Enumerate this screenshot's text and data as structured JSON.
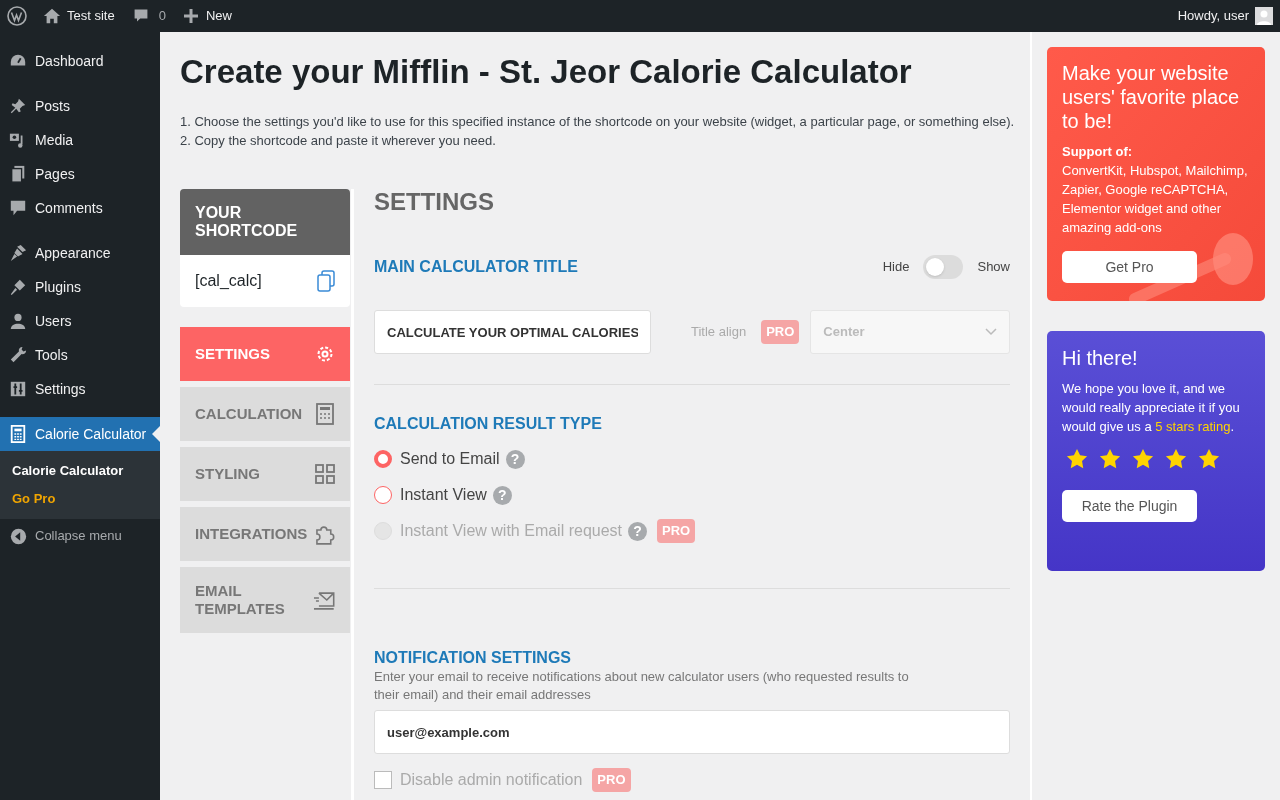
{
  "admin_bar": {
    "site": "Test site",
    "comments": "0",
    "new": "New",
    "greeting": "Howdy, user"
  },
  "menu": [
    {
      "items": [
        {
          "label": "Dashboard",
          "selected": false
        }
      ]
    },
    {
      "items": [
        {
          "label": "Posts",
          "selected": false
        },
        {
          "label": "Media",
          "selected": false
        },
        {
          "label": "Pages",
          "selected": false
        },
        {
          "label": "Comments",
          "selected": false
        }
      ]
    },
    {
      "items": [
        {
          "label": "Appearance",
          "selected": false
        },
        {
          "label": "Plugins",
          "selected": false
        },
        {
          "label": "Users",
          "selected": false
        },
        {
          "label": "Tools",
          "selected": false
        },
        {
          "label": "Settings",
          "selected": false
        }
      ]
    },
    {
      "items": [
        {
          "label": "Calorie Calculator",
          "selected": true
        }
      ]
    }
  ],
  "submenu": [
    {
      "label": "Calorie Calculator",
      "kind": "page",
      "selected": true
    },
    {
      "label": "Go Pro",
      "kind": "promo",
      "selected": false
    }
  ],
  "collapse": "Collapse menu",
  "page": {
    "title": "Create your Mifflin - St. Jeor Calorie Calculator",
    "instructions": [
      "1. Choose the settings you'd like to use for this specified instance of the shortcode on your website (widget, a particular page, or something else).",
      "2. Copy the shortcode and paste it wherever you need."
    ]
  },
  "shortcode": {
    "heading": "YOUR SHORTCODE",
    "code": "[cal_calc]"
  },
  "tabs": [
    {
      "label": "SETTINGS",
      "selected": true
    },
    {
      "label": "CALCULATION",
      "selected": false
    },
    {
      "label": "STYLING",
      "selected": false
    },
    {
      "label": "INTEGRATIONS",
      "selected": false
    },
    {
      "label": "EMAIL TEMPLATES",
      "selected": false
    }
  ],
  "settings": {
    "heading": "SETTINGS",
    "title_section": {
      "heading": "MAIN CALCULATOR TITLE",
      "hide_label": "Hide",
      "show_label": "Show",
      "on": false,
      "title_value": "CALCULATE YOUR OPTIMAL CALORIES",
      "align_label": "Title align",
      "align_badge": "PRO",
      "align_value": "Center"
    },
    "result_type": {
      "heading": "CALCULATION RESULT TYPE",
      "options": [
        {
          "label": "Send to Email",
          "help": "?",
          "selected": true,
          "disabled": false
        },
        {
          "label": "Instant View",
          "help": "?",
          "selected": false,
          "disabled": false
        },
        {
          "label": "Instant View with Email request",
          "help": "?",
          "badge": "PRO",
          "selected": false,
          "disabled": true
        }
      ]
    },
    "notification": {
      "heading": "NOTIFICATION SETTINGS",
      "description": "Enter your email to receive notifications about new calculator users (who requested results to their email) and their email addresses",
      "email": "user@example.com",
      "checkbox": {
        "label": "Disable admin notification",
        "badge": "PRO",
        "checked": false,
        "disabled": true
      }
    }
  },
  "pro_card": {
    "title": "Make your website users' favorite place to be!",
    "support_label": "Support of:",
    "support_text": "ConvertKit, Hubspot, Mailchimp, Zapier, Google reCAPTCHA, Elementor widget and other amazing add-ons",
    "button": "Get Pro"
  },
  "rating_card": {
    "title": "Hi there!",
    "text_before": "We hope you love it, and we would really appreciate it if you would give us a ",
    "link": "5 stars rating",
    "text_after": ".",
    "stars": 5,
    "button": "Rate the Plugin"
  }
}
